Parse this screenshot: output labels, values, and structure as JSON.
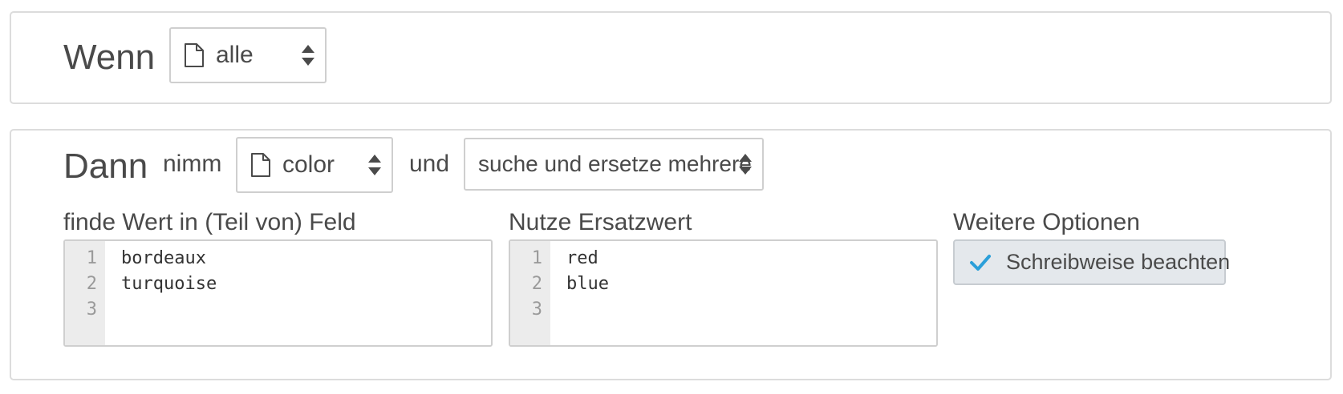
{
  "if_section": {
    "heading": "Wenn",
    "scope_select": {
      "value": "alle",
      "icon": "document-icon"
    }
  },
  "then_section": {
    "heading": "Dann",
    "take_label": "nimm",
    "field_select": {
      "value": "color",
      "icon": "document-icon"
    },
    "and_label": "und",
    "action_select": {
      "value": "suche und ersetze mehrere"
    },
    "find_label": "finde Wert in (Teil von) Feld",
    "find_editor": {
      "line_numbers": [
        "1",
        "2",
        "3"
      ],
      "lines": [
        "bordeaux",
        "turquoise",
        ""
      ]
    },
    "replace_label": "Nutze Ersatzwert",
    "replace_editor": {
      "line_numbers": [
        "1",
        "2",
        "3"
      ],
      "lines": [
        "red",
        "blue",
        ""
      ]
    },
    "options_label": "Weitere Optionen",
    "case_sensitive_toggle": {
      "label": "Schreibweise beachten",
      "checked": true,
      "icon": "check-icon",
      "check_color": "#2b9fd9"
    }
  }
}
